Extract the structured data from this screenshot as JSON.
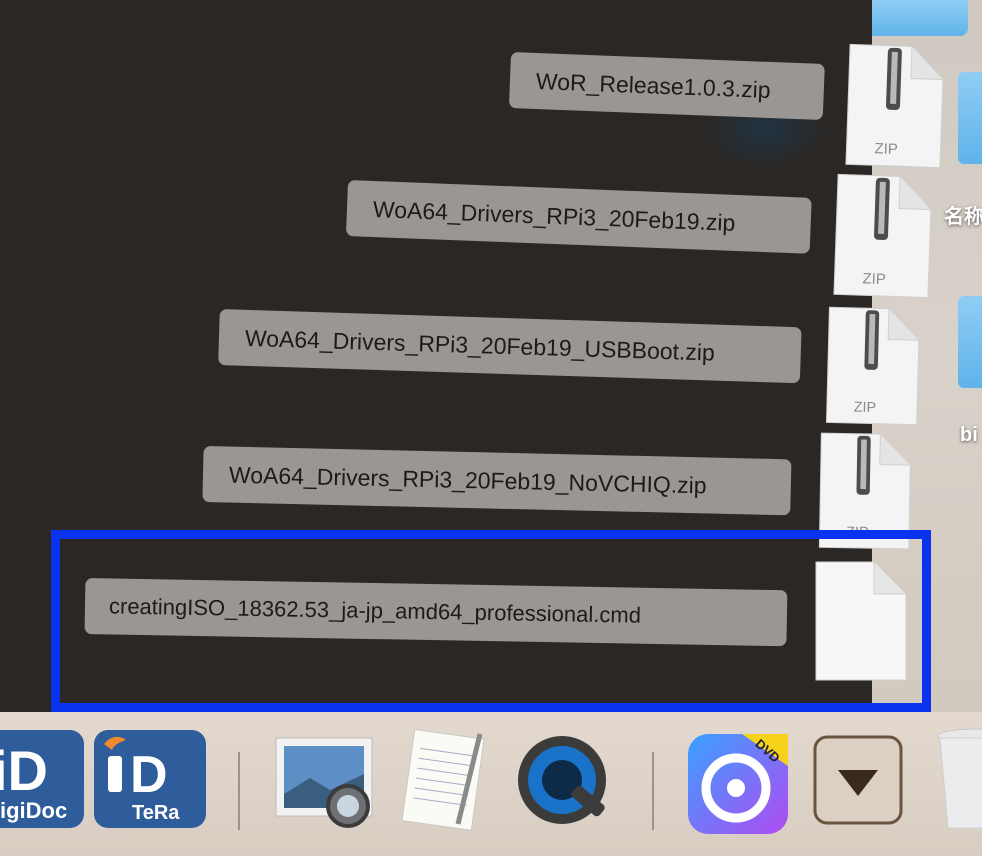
{
  "stack": {
    "items": [
      {
        "name": "WoR_Release1.0.3.zip",
        "type_label": "ZIP"
      },
      {
        "name": "WoA64_Drivers_RPi3_20Feb19.zip",
        "type_label": "ZIP"
      },
      {
        "name": "WoA64_Drivers_RPi3_20Feb19_USBBoot.zip",
        "type_label": "ZIP"
      },
      {
        "name": "WoA64_Drivers_RPi3_20Feb19_NoVCHIQ.zip",
        "type_label": "ZIP"
      },
      {
        "name": "creatingISO_18362.53_ja-jp_amd64_professional.cmd",
        "type_label": ""
      }
    ],
    "highlight_color": "#0a33f0"
  },
  "desktop": {
    "labels": [
      "名称",
      "bi"
    ]
  },
  "dock": {
    "apps": [
      {
        "label": "igiDoc",
        "icon": "digidoc-icon"
      },
      {
        "label": "TeRa",
        "icon": "tera-icon"
      },
      {
        "label": "",
        "icon": "preview-icon"
      },
      {
        "label": "",
        "icon": "textedit-icon"
      },
      {
        "label": "",
        "icon": "quicktime-icon"
      },
      {
        "label": "DVD",
        "icon": "dvd-player-icon"
      },
      {
        "label": "",
        "icon": "stack-arrow-icon"
      },
      {
        "label": "",
        "icon": "trash-icon"
      }
    ]
  }
}
